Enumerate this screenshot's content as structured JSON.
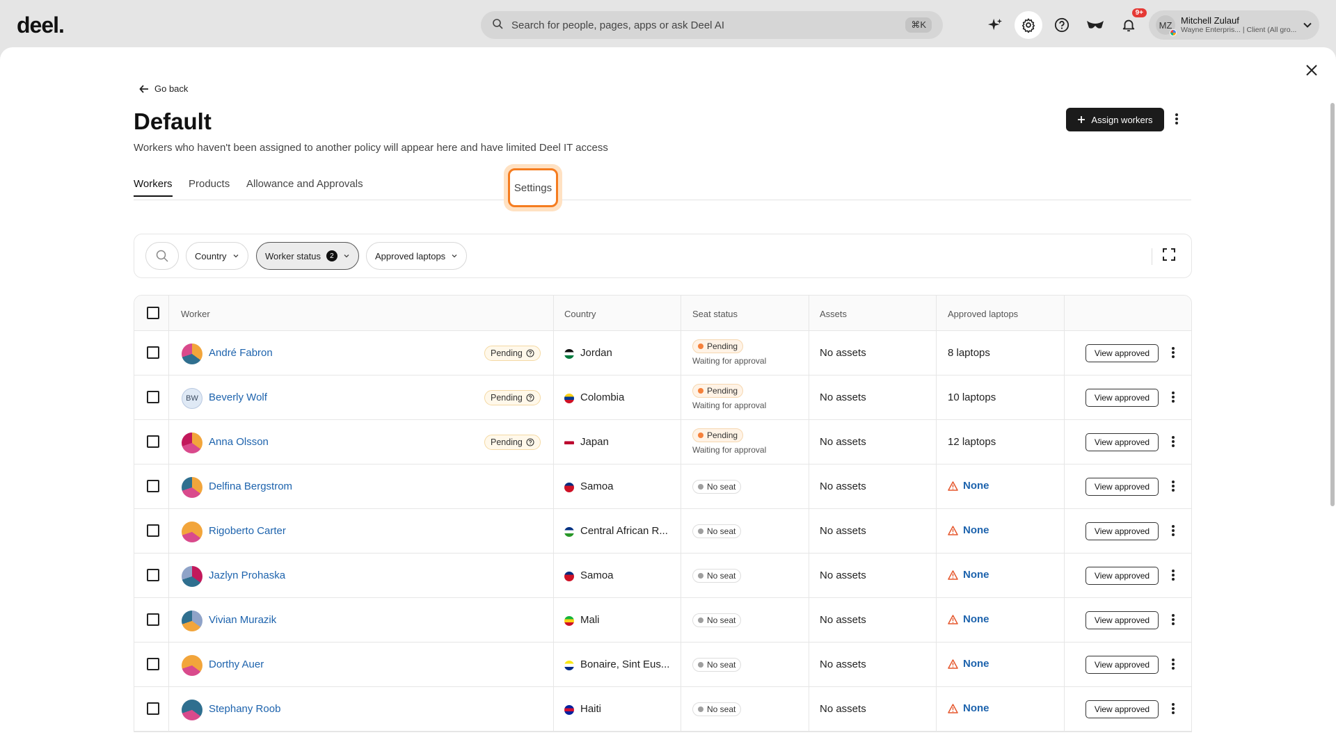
{
  "app": {
    "logo": "deel.",
    "search_placeholder": "Search for people, pages, apps or ask Deel AI",
    "search_shortcut": "⌘K",
    "notification_badge": "9+",
    "user": {
      "initials": "MZ",
      "name": "Mitchell Zulauf",
      "subtitle": "Wayne Enterpris... | Client (All gro..."
    }
  },
  "page": {
    "back_label": "Go back",
    "title": "Default",
    "description": "Workers who haven't been assigned to another policy will appear here and have limited Deel IT access",
    "assign_label": "Assign workers",
    "tabs": [
      "Workers",
      "Products",
      "Allowance and Approvals",
      "Settings"
    ]
  },
  "filters": {
    "country_label": "Country",
    "worker_status_label": "Worker status",
    "worker_status_count": "2",
    "laptops_label": "Approved laptops"
  },
  "table": {
    "headers": [
      "Worker",
      "Country",
      "Seat status",
      "Assets",
      "Approved laptops"
    ],
    "view_label": "View approved",
    "rows": [
      {
        "name": "André Fabron",
        "initials": "",
        "worker_pending": "Pending",
        "country": "Jordan",
        "seat": "Pending",
        "seat_sub": "Waiting for approval",
        "assets": "No assets",
        "laptops": "8 laptops",
        "avatar_colors": [
          "#f2a53b",
          "#2f6f8f",
          "#d94a8c"
        ],
        "flag_colors": [
          "#111",
          "#fff",
          "#007a3d"
        ]
      },
      {
        "name": "Beverly Wolf",
        "initials": "BW",
        "worker_pending": "Pending",
        "country": "Colombia",
        "seat": "Pending",
        "seat_sub": "Waiting for approval",
        "assets": "No assets",
        "laptops": "10 laptops",
        "avatar_colors": [],
        "flag_colors": [
          "#fcd116",
          "#003893",
          "#ce1126"
        ]
      },
      {
        "name": "Anna Olsson",
        "initials": "",
        "worker_pending": "Pending",
        "country": "Japan",
        "seat": "Pending",
        "seat_sub": "Waiting for approval",
        "assets": "No assets",
        "laptops": "12 laptops",
        "avatar_colors": [
          "#f2a53b",
          "#d94a8c",
          "#c2185b"
        ],
        "flag_colors": [
          "#fff",
          "#bc002d",
          "#fff"
        ]
      },
      {
        "name": "Delfina Bergstrom",
        "initials": "",
        "worker_pending": "",
        "country": "Samoa",
        "seat": "No seat",
        "seat_sub": "",
        "assets": "No assets",
        "laptops": "None",
        "avatar_colors": [
          "#f2a53b",
          "#d94a8c",
          "#2f6f8f"
        ],
        "flag_colors": [
          "#002b7f",
          "#ce1126",
          "#ce1126"
        ]
      },
      {
        "name": "Rigoberto Carter",
        "initials": "",
        "worker_pending": "",
        "country": "Central African R...",
        "seat": "No seat",
        "seat_sub": "",
        "assets": "No assets",
        "laptops": "None",
        "avatar_colors": [
          "#f2a53b",
          "#d94a8c",
          "#f2a53b"
        ],
        "flag_colors": [
          "#003082",
          "#fff",
          "#289728"
        ]
      },
      {
        "name": "Jazlyn Prohaska",
        "initials": "",
        "worker_pending": "",
        "country": "Samoa",
        "seat": "No seat",
        "seat_sub": "",
        "assets": "No assets",
        "laptops": "None",
        "avatar_colors": [
          "#c2185b",
          "#2f6f8f",
          "#8fa3c8"
        ],
        "flag_colors": [
          "#002b7f",
          "#ce1126",
          "#ce1126"
        ]
      },
      {
        "name": "Vivian Murazik",
        "initials": "",
        "worker_pending": "",
        "country": "Mali",
        "seat": "No seat",
        "seat_sub": "",
        "assets": "No assets",
        "laptops": "None",
        "avatar_colors": [
          "#8fa3c8",
          "#f2a53b",
          "#2f6f8f"
        ],
        "flag_colors": [
          "#14b53a",
          "#fcd116",
          "#ce1126"
        ]
      },
      {
        "name": "Dorthy Auer",
        "initials": "",
        "worker_pending": "",
        "country": "Bonaire, Sint Eus...",
        "seat": "No seat",
        "seat_sub": "",
        "assets": "No assets",
        "laptops": "None",
        "avatar_colors": [
          "#f2a53b",
          "#d94a8c",
          "#f2a53b"
        ],
        "flag_colors": [
          "#f9e814",
          "#fff",
          "#012a87"
        ]
      },
      {
        "name": "Stephany Roob",
        "initials": "",
        "worker_pending": "",
        "country": "Haiti",
        "seat": "No seat",
        "seat_sub": "",
        "assets": "No assets",
        "laptops": "None",
        "avatar_colors": [
          "#2f6f8f",
          "#d94a8c",
          "#2f6f8f"
        ],
        "flag_colors": [
          "#00209f",
          "#d21034",
          "#00209f"
        ]
      }
    ]
  },
  "colors": {
    "link": "#1d63ad",
    "accent_ring": "#f57c1f",
    "pending_dot": "#f5813b",
    "noseat_dot": "#9e9e9e",
    "warning": "#e5562c"
  }
}
